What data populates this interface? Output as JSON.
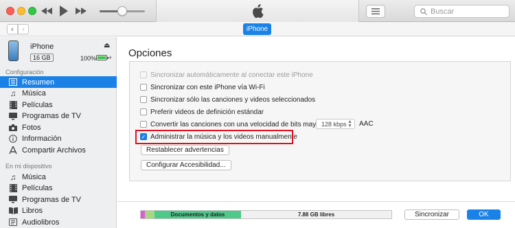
{
  "toolbar": {
    "search_placeholder": "Buscar"
  },
  "nav": {
    "back": "‹",
    "forward": "›",
    "device_pill": "iPhone"
  },
  "device": {
    "name": "iPhone",
    "capacity": "16 GB",
    "battery_pct": "100%",
    "battery_level": 1.0
  },
  "sidebar": {
    "section_config": "Configuración",
    "config_items": [
      {
        "label": "Resumen",
        "icon": "summary-icon"
      },
      {
        "label": "Música",
        "icon": "music-note-icon"
      },
      {
        "label": "Películas",
        "icon": "film-icon"
      },
      {
        "label": "Programas de TV",
        "icon": "tv-icon"
      },
      {
        "label": "Fotos",
        "icon": "camera-icon"
      },
      {
        "label": "Información",
        "icon": "info-icon"
      },
      {
        "label": "Compartir Archivos",
        "icon": "apps-icon"
      }
    ],
    "section_device": "En mi dispositivo",
    "device_items": [
      {
        "label": "Música",
        "icon": "music-note-icon"
      },
      {
        "label": "Películas",
        "icon": "film-icon"
      },
      {
        "label": "Programas de TV",
        "icon": "tv-icon"
      },
      {
        "label": "Libros",
        "icon": "book-icon"
      },
      {
        "label": "Audiolibros",
        "icon": "audiobook-icon"
      }
    ]
  },
  "options": {
    "title": "Opciones",
    "auto_sync": "Sincronizar automáticamente al conectar este iPhone",
    "wifi_sync": "Sincronizar con este iPhone vía Wi-Fi",
    "selected_only": "Sincronizar sólo las canciones y videos seleccionados",
    "prefer_sd": "Preferir videos de definición estándar",
    "convert_bitrate": "Convertir las canciones con una velocidad de bits mayor a",
    "bitrate_value": "128 kbps",
    "format": "AAC",
    "manual_manage": "Administrar la música y los videos manualmente",
    "reset_warnings": "Restablecer advertencias",
    "accessibility": "Configurar Accesibilidad..."
  },
  "storage": {
    "documents_label": "Documentos y datos",
    "free_label": "7.88 GB libres"
  },
  "footer": {
    "sync_label": "Sincronizar",
    "ok_label": "OK"
  },
  "colors": {
    "accent": "#1a82e6",
    "highlight_border": "#e3101e",
    "storage_pink": "#e05bd3",
    "storage_green": "#a6d782",
    "storage_docs": "#4ec98a"
  }
}
